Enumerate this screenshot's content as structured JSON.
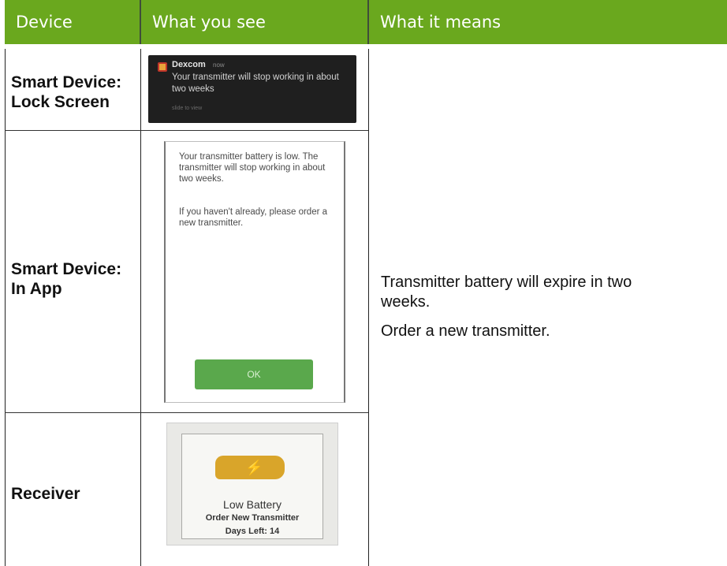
{
  "header": {
    "col1": "Device",
    "col2": "What you see",
    "col3": "What it means"
  },
  "rows": [
    {
      "device_line1": "Smart Device:",
      "device_line2": "Lock Screen",
      "notification": {
        "app_name": "Dexcom",
        "time": "now",
        "message": "Your transmitter will stop working in about two weeks",
        "hint": "slide to view"
      }
    },
    {
      "device_line1": "Smart Device:",
      "device_line2": "In App",
      "dialog": {
        "message1": "Your transmitter battery is low. The transmitter will stop working in about two weeks.",
        "message2": "If you haven't already, please order a new transmitter.",
        "button": "OK"
      }
    },
    {
      "device_line1": "Receiver",
      "screen": {
        "title": "Low Battery",
        "line2": "Order New Transmitter",
        "line3": "Days Left: 14"
      }
    }
  ],
  "meaning": {
    "line1": "Transmitter battery will expire in two",
    "line2": "weeks.",
    "line3": "Order a new transmitter."
  },
  "colors": {
    "header_bg": "#6aa81e",
    "ok_button": "#5aa84c",
    "battery": "#d9a52a"
  }
}
